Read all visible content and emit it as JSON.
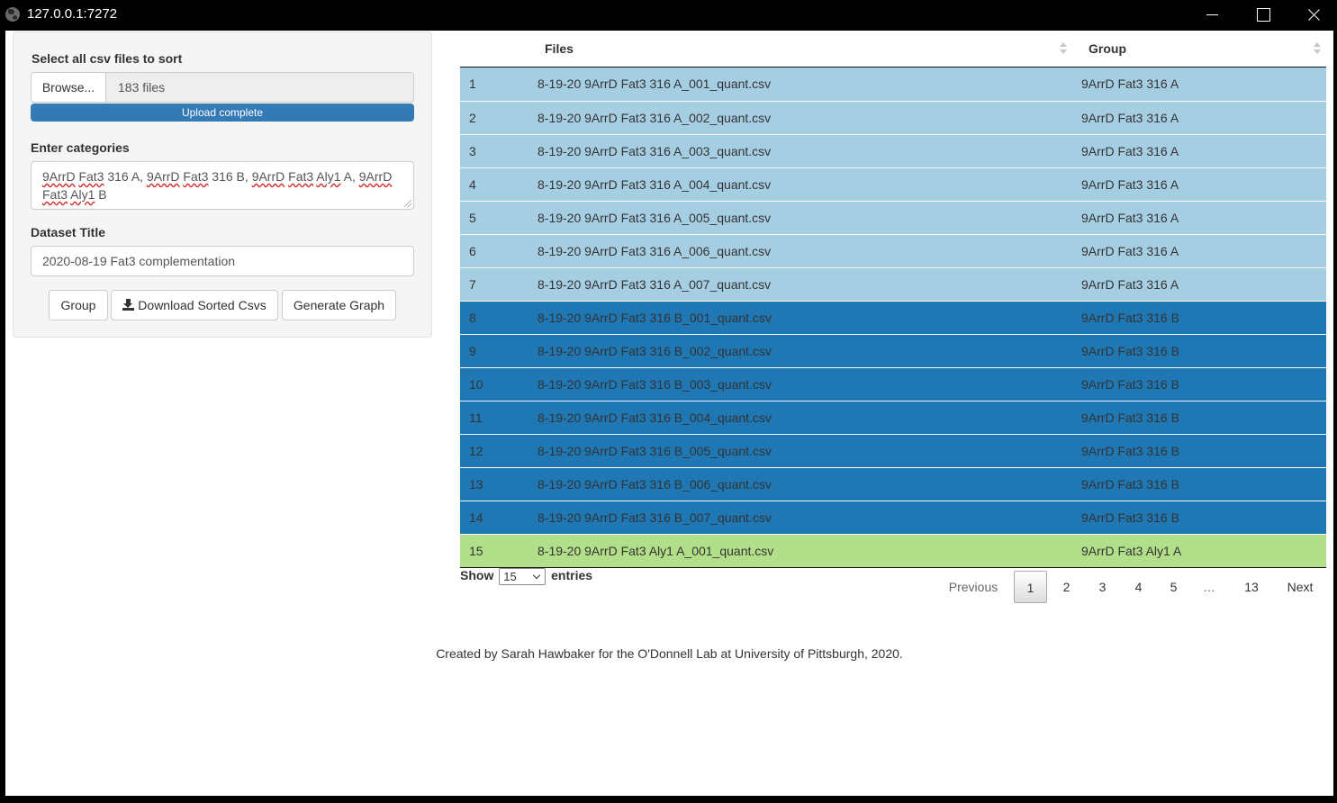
{
  "window": {
    "title": "127.0.0.1:7272"
  },
  "sidebar": {
    "files_label": "Select all csv files to sort",
    "browse_label": "Browse...",
    "file_count": "183 files",
    "upload_status": "Upload complete",
    "categories_label": "Enter categories",
    "categories_segments": [
      "9ArrD",
      " ",
      "Fat3",
      " 316 A, ",
      "9ArrD",
      " ",
      "Fat3",
      " 316 B, ",
      "9ArrD",
      " ",
      "Fat3",
      " ",
      "Aly1",
      " A, ",
      "9ArrD",
      " ",
      "Fat3",
      " ",
      "Aly1",
      " B"
    ],
    "title_label": "Dataset Title",
    "title_value": "2020-08-19 Fat3 complementation",
    "buttons": {
      "group": "Group",
      "download": "Download Sorted Csvs",
      "graph": "Generate Graph"
    }
  },
  "table": {
    "columns": [
      "",
      "Files",
      "Group"
    ],
    "group_colors": {
      "9ArrD Fat3 316 A": "#a6cee3",
      "9ArrD Fat3 316 B": "#1f78b4",
      "9ArrD Fat3 Aly1 A": "#b2df8a"
    },
    "rows": [
      {
        "n": "1",
        "file": "8-19-20 9ArrD Fat3 316 A_001_quant.csv",
        "group": "9ArrD Fat3 316 A"
      },
      {
        "n": "2",
        "file": "8-19-20 9ArrD Fat3 316 A_002_quant.csv",
        "group": "9ArrD Fat3 316 A"
      },
      {
        "n": "3",
        "file": "8-19-20 9ArrD Fat3 316 A_003_quant.csv",
        "group": "9ArrD Fat3 316 A"
      },
      {
        "n": "4",
        "file": "8-19-20 9ArrD Fat3 316 A_004_quant.csv",
        "group": "9ArrD Fat3 316 A"
      },
      {
        "n": "5",
        "file": "8-19-20 9ArrD Fat3 316 A_005_quant.csv",
        "group": "9ArrD Fat3 316 A"
      },
      {
        "n": "6",
        "file": "8-19-20 9ArrD Fat3 316 A_006_quant.csv",
        "group": "9ArrD Fat3 316 A"
      },
      {
        "n": "7",
        "file": "8-19-20 9ArrD Fat3 316 A_007_quant.csv",
        "group": "9ArrD Fat3 316 A"
      },
      {
        "n": "8",
        "file": "8-19-20 9ArrD Fat3 316 B_001_quant.csv",
        "group": "9ArrD Fat3 316 B"
      },
      {
        "n": "9",
        "file": "8-19-20 9ArrD Fat3 316 B_002_quant.csv",
        "group": "9ArrD Fat3 316 B"
      },
      {
        "n": "10",
        "file": "8-19-20 9ArrD Fat3 316 B_003_quant.csv",
        "group": "9ArrD Fat3 316 B"
      },
      {
        "n": "11",
        "file": "8-19-20 9ArrD Fat3 316 B_004_quant.csv",
        "group": "9ArrD Fat3 316 B"
      },
      {
        "n": "12",
        "file": "8-19-20 9ArrD Fat3 316 B_005_quant.csv",
        "group": "9ArrD Fat3 316 B"
      },
      {
        "n": "13",
        "file": "8-19-20 9ArrD Fat3 316 B_006_quant.csv",
        "group": "9ArrD Fat3 316 B"
      },
      {
        "n": "14",
        "file": "8-19-20 9ArrD Fat3 316 B_007_quant.csv",
        "group": "9ArrD Fat3 316 B"
      },
      {
        "n": "15",
        "file": "8-19-20 9ArrD Fat3 Aly1 A_001_quant.csv",
        "group": "9ArrD Fat3 Aly1 A"
      }
    ]
  },
  "length": {
    "show": "Show",
    "value": "15",
    "entries": "entries"
  },
  "pagination": {
    "previous": "Previous",
    "pages": [
      "1",
      "2",
      "3",
      "4",
      "5",
      "…",
      "13"
    ],
    "current": "1",
    "next": "Next"
  },
  "footer": "Created by Sarah Hawbaker for the O'Donnell Lab at University of Pittsburgh, 2020."
}
